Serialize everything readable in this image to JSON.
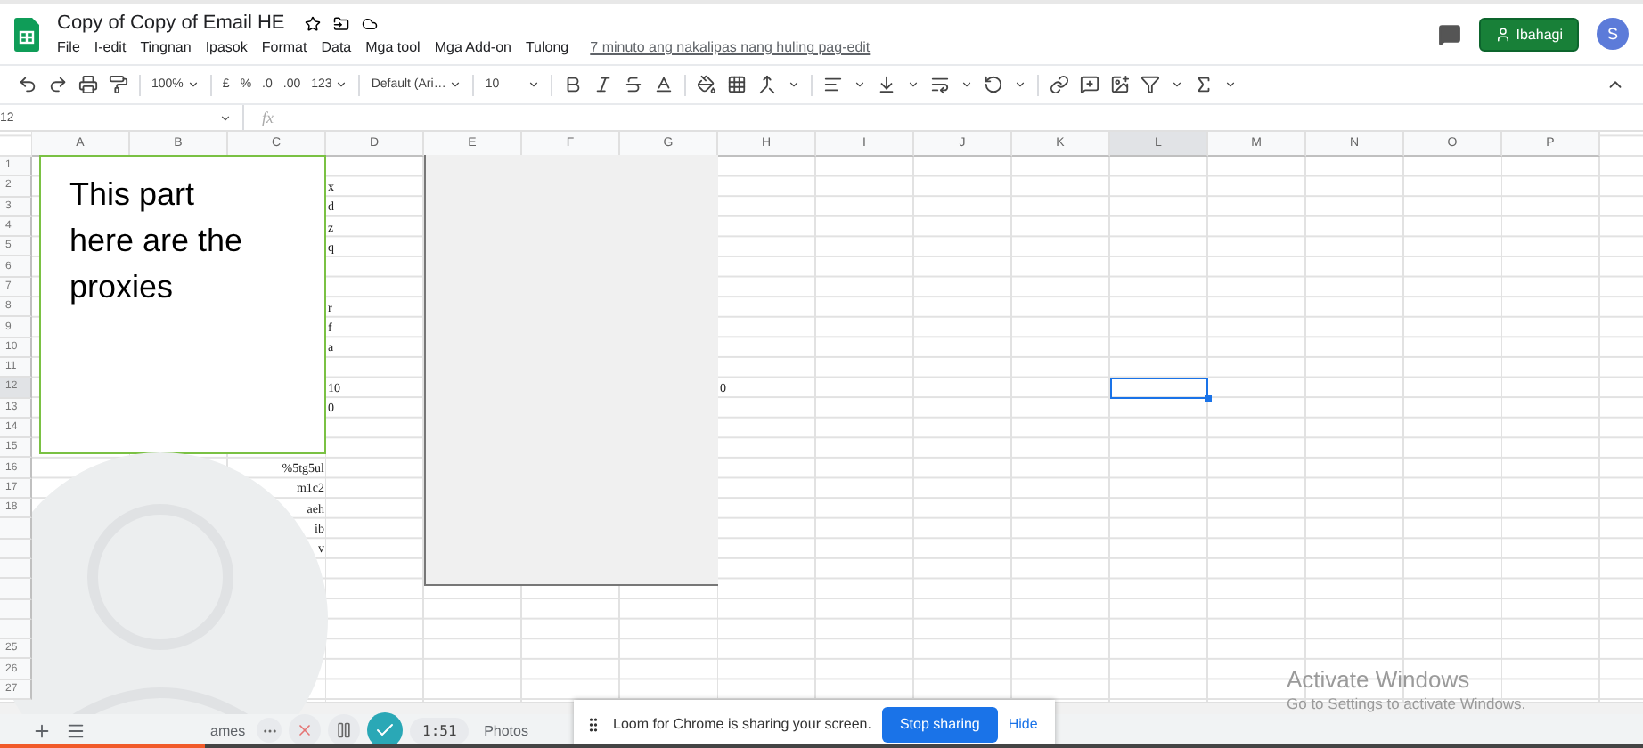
{
  "document": {
    "title": "Copy of Copy of Email HE",
    "last_edit": "7 minuto ang nakalipas nang huling pag-edit"
  },
  "menus": [
    "File",
    "I-edit",
    "Tingnan",
    "Ipasok",
    "Format",
    "Data",
    "Mga tool",
    "Mga Add-on",
    "Tulong"
  ],
  "share_button": "Ibahagi",
  "avatar": "S",
  "toolbar": {
    "zoom": "100%",
    "currency": "£",
    "percent": "%",
    "decrease_decimals": ".0",
    "increase_decimals": ".00",
    "number_format": "123",
    "font": "Default (Ari…",
    "font_size": "10"
  },
  "name_box": "12",
  "formula_label": "fx",
  "columns": [
    {
      "label": "A",
      "selected": false
    },
    {
      "label": "B",
      "selected": false
    },
    {
      "label": "C",
      "selected": false
    },
    {
      "label": "D",
      "selected": false
    },
    {
      "label": "E",
      "selected": false
    },
    {
      "label": "F",
      "selected": false
    },
    {
      "label": "G",
      "selected": false
    },
    {
      "label": "H",
      "selected": false
    },
    {
      "label": "I",
      "selected": false
    },
    {
      "label": "J",
      "selected": false
    },
    {
      "label": "K",
      "selected": false
    },
    {
      "label": "L",
      "selected": true
    },
    {
      "label": "M",
      "selected": false
    },
    {
      "label": "N",
      "selected": false
    },
    {
      "label": "O",
      "selected": false
    },
    {
      "label": "P",
      "selected": false
    }
  ],
  "rows": [
    {
      "label": "1",
      "selected": false
    },
    {
      "label": "2",
      "selected": false,
      "column_d": "x"
    },
    {
      "label": "3",
      "selected": false,
      "column_d": "d"
    },
    {
      "label": "4",
      "selected": false,
      "column_d": "z"
    },
    {
      "label": "5",
      "selected": false,
      "column_d": "q"
    },
    {
      "label": "6",
      "selected": false
    },
    {
      "label": "7",
      "selected": false
    },
    {
      "label": "8",
      "selected": false,
      "column_d": "r"
    },
    {
      "label": "9",
      "selected": false,
      "column_d": "f"
    },
    {
      "label": "10",
      "selected": false,
      "column_d": "a"
    },
    {
      "label": "11",
      "selected": false
    },
    {
      "label": "12",
      "selected": true,
      "column_d": "10",
      "column_h": "0"
    },
    {
      "label": "13",
      "selected": false,
      "column_d": "0"
    },
    {
      "label": "14",
      "selected": false
    },
    {
      "label": "15",
      "selected": false
    },
    {
      "label": "16",
      "selected": false,
      "column_c": "%5tg5ul"
    },
    {
      "label": "17",
      "selected": false,
      "column_c": "m1c2"
    },
    {
      "label": "18",
      "selected": false,
      "column_c": "aeh"
    },
    {
      "selected": false,
      "column_c": "ib"
    },
    {
      "selected": false,
      "column_c": "v"
    },
    {
      "selected": false
    },
    {
      "selected": false
    },
    {
      "selected": false
    },
    {
      "selected": false
    },
    {
      "label": "25",
      "selected": false
    },
    {
      "label": "26",
      "selected": false
    },
    {
      "label": "27",
      "selected": false
    }
  ],
  "note_card": {
    "text": "This part here are the proxies"
  },
  "sheet_tabs": [
    {
      "label": "ames",
      "selected": false
    },
    {
      "label": "Photos",
      "selected": false
    }
  ],
  "recorder": {
    "timer": "1:51"
  },
  "recording_progress": {
    "level": 0.125
  },
  "share_notice": {
    "message": "Loom for Chrome is sharing your screen.",
    "stop_button": "Stop sharing",
    "hide_link": "Hide"
  },
  "os_notice": {
    "title": "Activate Windows",
    "message": "Go to Settings to activate Windows."
  }
}
